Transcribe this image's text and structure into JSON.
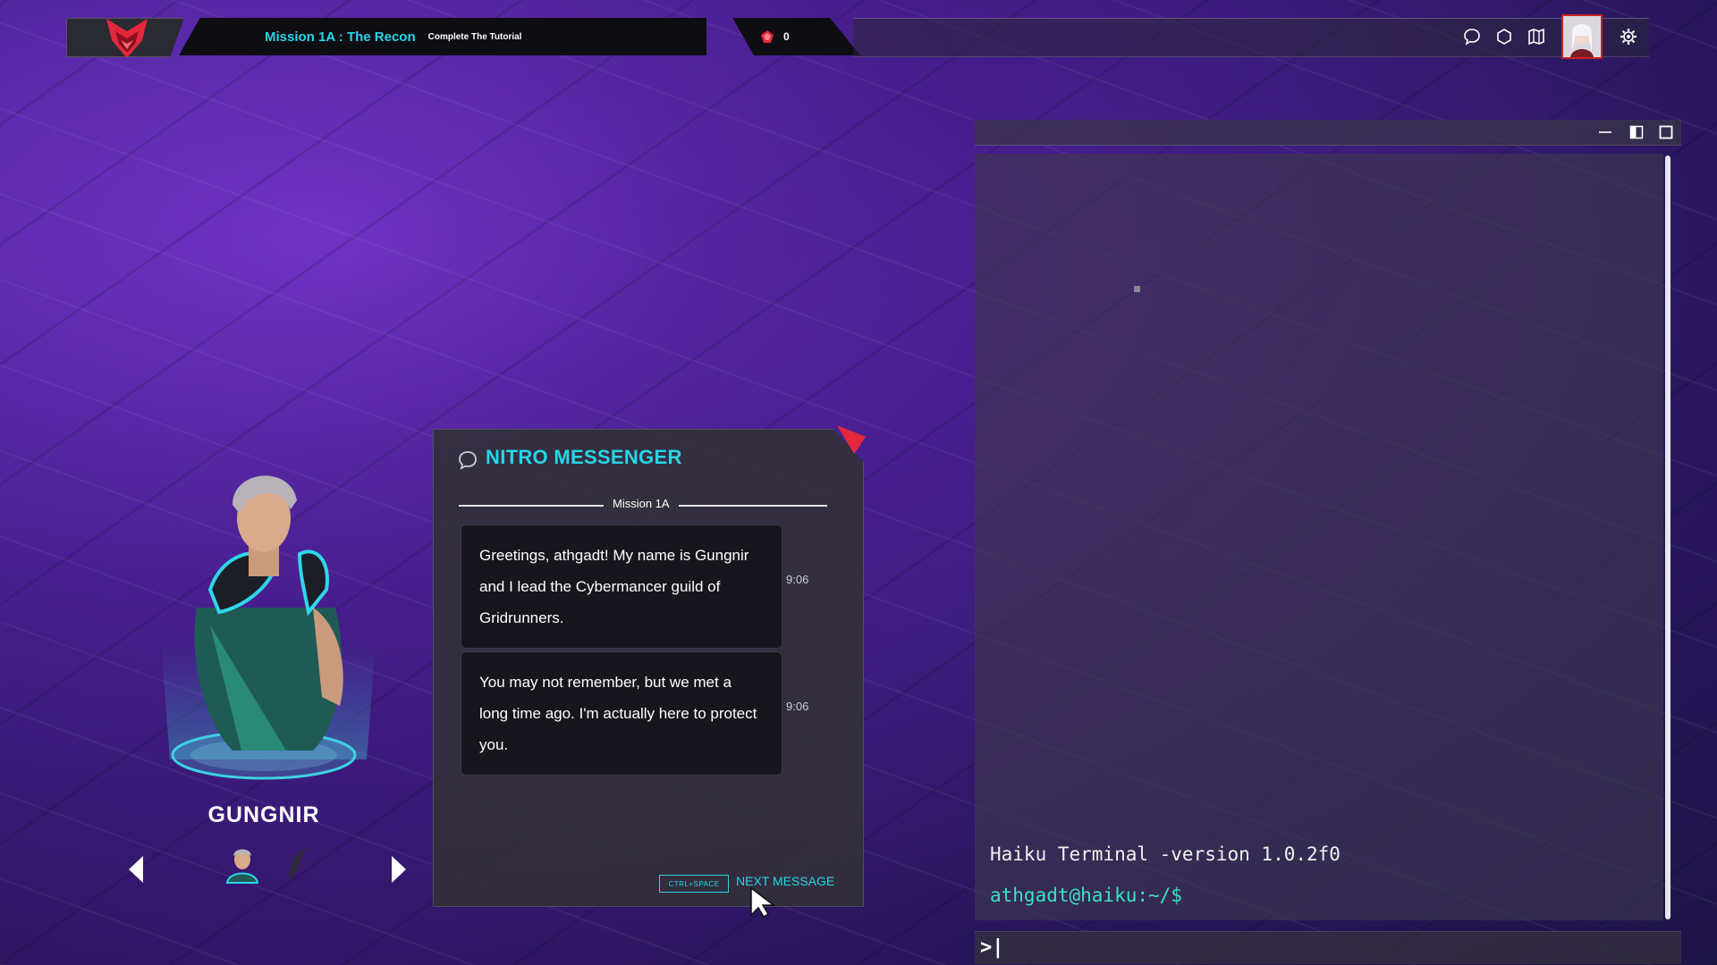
{
  "topbar": {
    "mission_title": "Mission 1A : The Recon",
    "mission_subtitle": "Complete The Tutorial",
    "counter_value": "0",
    "icons": [
      "chat-icon",
      "hexagon-icon",
      "map-icon",
      "avatar",
      "gear-icon"
    ]
  },
  "messenger": {
    "title": "NITRO MESSENGER",
    "section_label": "Mission 1A",
    "messages": [
      {
        "text": "Greetings, athgadt! My name is Gungnir and I lead the Cybermancer guild of Gridrunners.",
        "time": "9:06"
      },
      {
        "text": "You may not remember, but we met a long time ago. I'm actually here to protect you.",
        "time": "9:06"
      }
    ],
    "next_key": "CTRL+SPACE",
    "next_label": "NEXT MESSAGE"
  },
  "character": {
    "name": "GUNGNIR"
  },
  "terminal": {
    "version_line": "Haiku Terminal -version 1.0.2f0",
    "prompt_line": "athgadt@haiku:~/$",
    "input_prompt": ">|"
  },
  "colors": {
    "accent_cyan": "#27d6e6",
    "accent_red": "#e3283c",
    "prompt_green": "#3fe0c2"
  }
}
